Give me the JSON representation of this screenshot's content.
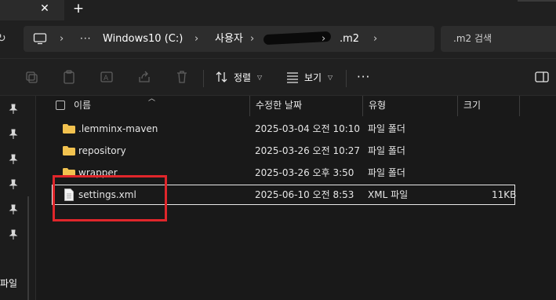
{
  "tabbar": {
    "close_glyph": "✕",
    "new_tab_glyph": "+"
  },
  "address": {
    "items": [
      "Windows10 (C:)",
      "사용자",
      ".m2"
    ],
    "more_glyph": "···",
    "separator": "›"
  },
  "search": {
    "placeholder": ".m2 검색"
  },
  "toolbar": {
    "sort_label": "정렬",
    "view_label": "보기",
    "more_glyph": "···",
    "icons": [
      "cut-icon",
      "copy-icon",
      "rename-icon",
      "share-icon",
      "delete-icon",
      "sort-icon",
      "view-icon",
      "details-pane-icon"
    ]
  },
  "nav": {
    "partial_label": "파일"
  },
  "columns": {
    "name": "이름",
    "modified": "수정한 날짜",
    "type": "유형",
    "size": "크기"
  },
  "files": [
    {
      "name": ".lemminx-maven",
      "modified": "2025-03-04 오전 10:10",
      "type": "파일 폴더",
      "size": "",
      "kind": "folder"
    },
    {
      "name": "repository",
      "modified": "2025-03-26 오전 10:27",
      "type": "파일 폴더",
      "size": "",
      "kind": "folder"
    },
    {
      "name": "wrapper",
      "modified": "2025-03-26 오후 3:50",
      "type": "파일 폴더",
      "size": "",
      "kind": "folder"
    },
    {
      "name": "settings.xml",
      "modified": "2025-06-10 오전 8:53",
      "type": "XML 파일",
      "size": "11KB",
      "kind": "file",
      "selected": true
    }
  ],
  "colors": {
    "folder": "#f2c24f",
    "annotation": "#e0262b",
    "background": "#191919"
  }
}
